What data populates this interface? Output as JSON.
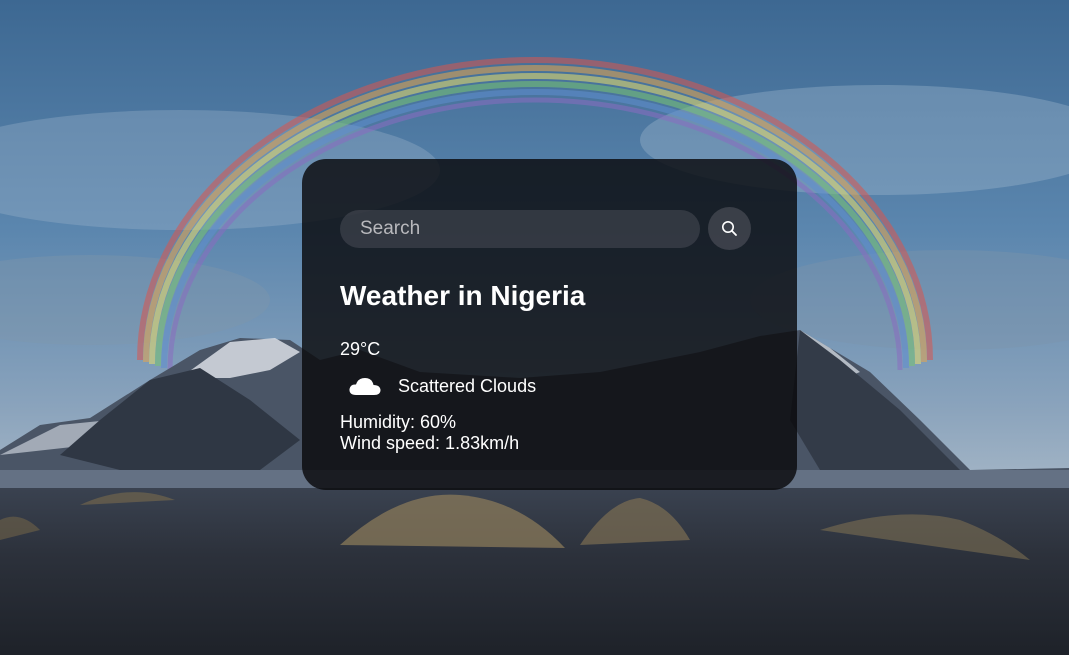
{
  "background": {
    "description_icon": "mountain-rainbow-landscape"
  },
  "search": {
    "placeholder": "Search",
    "value": "",
    "button_icon": "search-icon"
  },
  "weather": {
    "title": "Weather in Nigeria",
    "temperature": "29°C",
    "condition_icon": "cloud-icon",
    "description": "Scattered Clouds",
    "humidity": "Humidity: 60%",
    "wind": "Wind speed: 1.83km/h"
  },
  "colors": {
    "card_bg": "#0a0a0c",
    "text": "#ffffff",
    "placeholder": "#b9b9bd"
  }
}
